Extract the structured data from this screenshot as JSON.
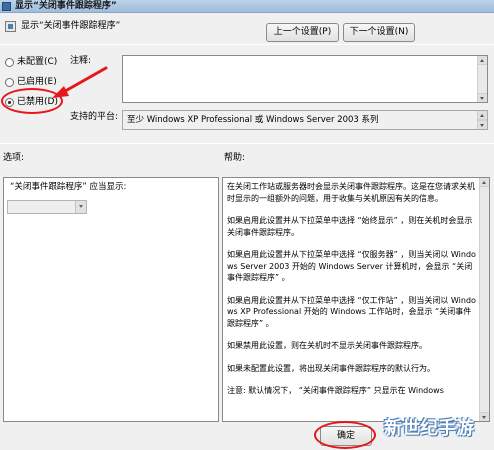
{
  "window": {
    "title": "显示“关闭事件跟踪程序”"
  },
  "header": {
    "policy_title": "显示“关闭事件跟踪程序”",
    "prev_label": "上一个设置(P)",
    "next_label": "下一个设置(N)"
  },
  "state": {
    "options": [
      {
        "label": "未配置(C)",
        "checked": false
      },
      {
        "label": "已启用(E)",
        "checked": false
      },
      {
        "label": "已禁用(D)",
        "checked": true
      }
    ]
  },
  "comment": {
    "label": "注释:",
    "value": ""
  },
  "platform": {
    "label": "支持的平台:",
    "value": "至少 Windows XP Professional 或 Windows Server 2003 系列"
  },
  "options_panel": {
    "heading": "选项:",
    "prompt": "“关闭事件跟踪程序” 应当显示:",
    "select_value": ""
  },
  "help_panel": {
    "heading": "帮助:",
    "paragraphs": [
      "在关闭工作站或服务器时会显示关闭事件跟踪程序。这是在您请求关机时显示的一组额外的问题，用于收集与关机原因有关的信息。",
      "如果启用此设置并从下拉菜单中选择 “始终显示” ，则在关机时会显示关闭事件跟踪程序。",
      "如果启用此设置并从下拉菜单中选择 “仅服务器” ，则当关闭以 Windows Server 2003 开始的 Windows Server 计算机时，会显示 “关闭事件跟踪程序” 。",
      "如果启用此设置并从下拉菜单中选择 “仅工作站” ，则当关闭以 Windows XP Professional 开始的 Windows 工作站时，会显示 “关闭事件跟踪程序” 。",
      "如果禁用此设置，则在关机时不显示关闭事件跟踪程序。",
      "如果未配置此设置，将出现关闭事件跟踪程序的默认行为。",
      "注意: 默认情况下， “关闭事件跟踪程序” 只显示在 Windows"
    ]
  },
  "footer": {
    "ok_label": "确定"
  },
  "watermark": {
    "text": "新世纪手游"
  },
  "colors": {
    "annotation": "#e8161b",
    "title_bar": "#9fbcdb"
  }
}
